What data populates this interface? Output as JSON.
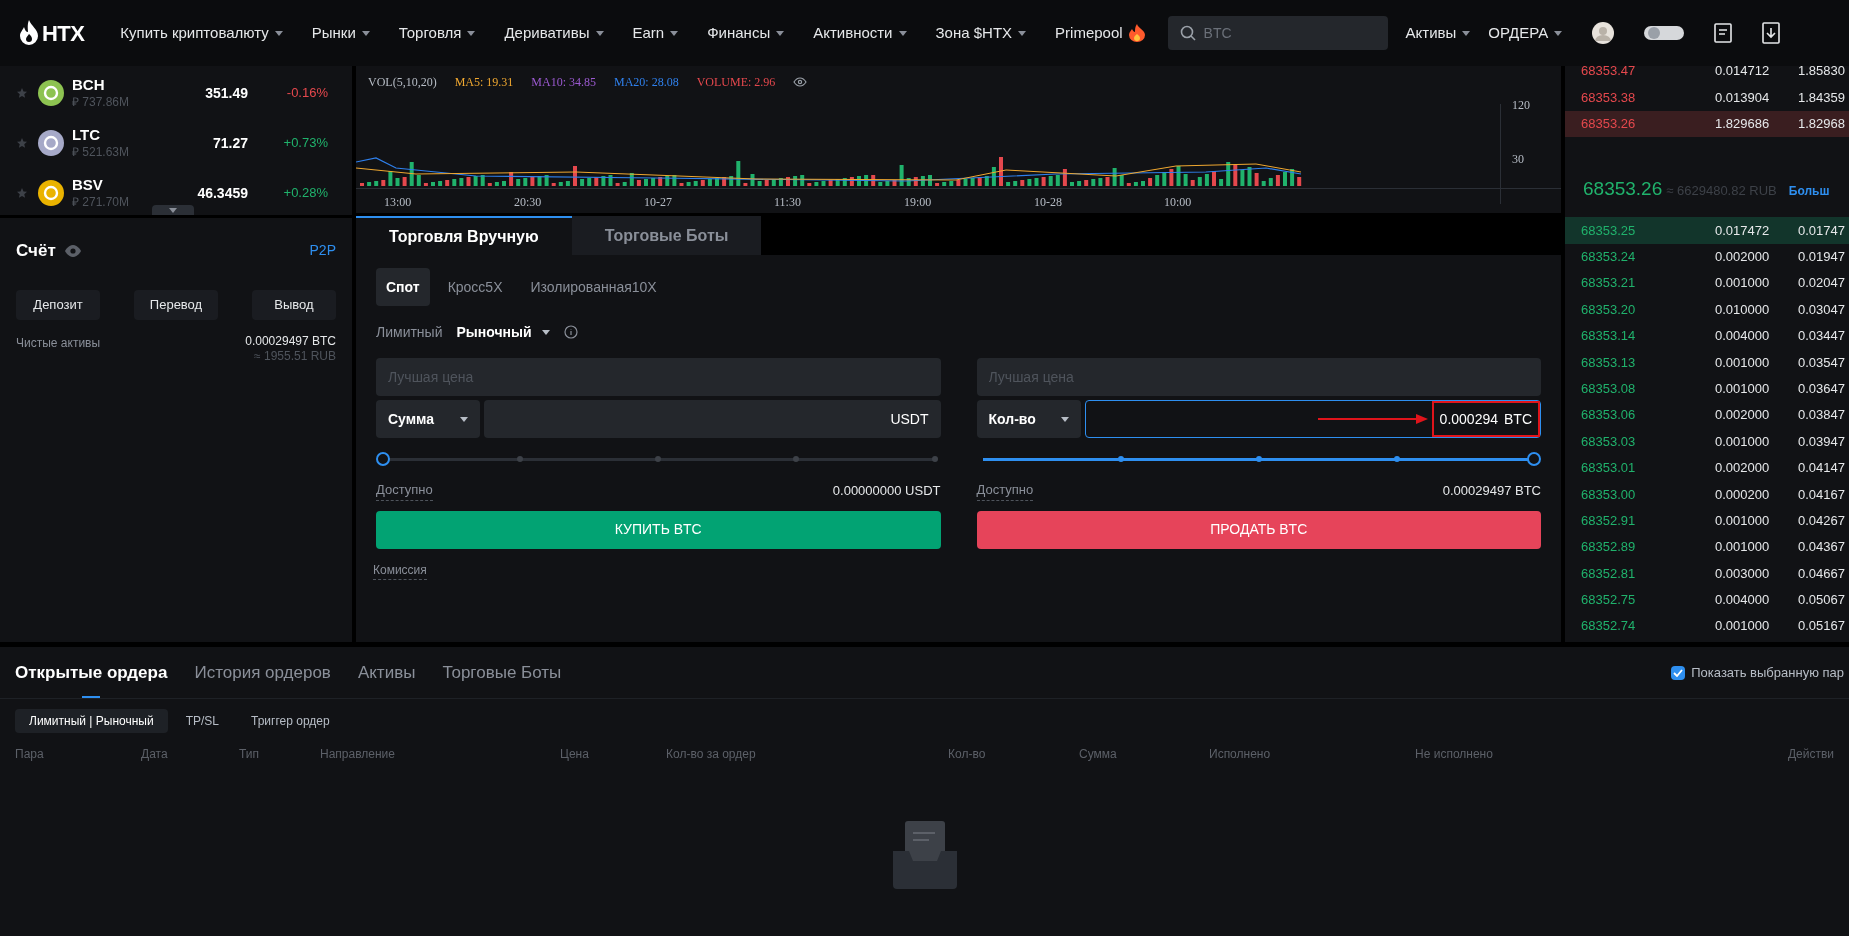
{
  "header": {
    "logo": "HTX",
    "nav": [
      {
        "label": "Купить криптовалюту",
        "has_menu": true,
        "hot": false
      },
      {
        "label": "Рынки",
        "has_menu": true,
        "hot": false
      },
      {
        "label": "Торговля",
        "has_menu": true,
        "hot": false
      },
      {
        "label": "Деривативы",
        "has_menu": true,
        "hot": false
      },
      {
        "label": "Earn",
        "has_menu": true,
        "hot": false
      },
      {
        "label": "Финансы",
        "has_menu": true,
        "hot": false
      },
      {
        "label": "Активности",
        "has_menu": true,
        "hot": false
      },
      {
        "label": "Зона $HTX",
        "has_menu": true,
        "hot": false
      },
      {
        "label": "Primepool",
        "has_menu": false,
        "hot": true
      }
    ],
    "search": {
      "placeholder": "BTC"
    },
    "right_menus": [
      {
        "label": "Активы"
      },
      {
        "label": "ОРДЕРА"
      }
    ]
  },
  "markets": [
    {
      "symbol": "BCH",
      "volume": "₽ 737.86M",
      "price": "351.49",
      "change": "-0.16%",
      "falling": true,
      "color": "#8dc351"
    },
    {
      "symbol": "LTC",
      "volume": "₽ 521.63M",
      "price": "71.27",
      "change": "+0.73%",
      "falling": false,
      "color": "#a6a9c8"
    },
    {
      "symbol": "BSV",
      "volume": "₽ 271.70M",
      "price": "46.3459",
      "change": "+0.28%",
      "falling": false,
      "color": "#eab300"
    }
  ],
  "account": {
    "title": "Счёт",
    "link": "P2P",
    "buttons": [
      "Депозит",
      "Перевод",
      "Вывод"
    ],
    "net_label": "Чистые активы",
    "net_value": "0.00029497 BTC",
    "net_approx": "≈ 1955.51 RUB"
  },
  "chart": {
    "legend": [
      {
        "text": "VOL(5,10,20)",
        "color": "#b7bdc6"
      },
      {
        "text": "MA5: 19.31",
        "color": "#f0a830"
      },
      {
        "text": "MA10: 34.85",
        "color": "#9b59d0"
      },
      {
        "text": "MA20: 28.08",
        "color": "#2f80ed"
      },
      {
        "text": "VOLUME: 2.96",
        "color": "#e5484d"
      }
    ],
    "y_labels": [
      "120",
      "30"
    ],
    "x_labels": [
      "13:00",
      "20:30",
      "10-27",
      "11:30",
      "19:00",
      "10-28",
      "10:00"
    ]
  },
  "trade": {
    "tabs": [
      {
        "label": "Торговля Вручную",
        "selected": true
      },
      {
        "label": "Торговые Боты",
        "selected": false
      }
    ],
    "margin_tabs": [
      {
        "label": "Спот",
        "selected": true
      },
      {
        "label": "Кросс5X",
        "selected": false
      },
      {
        "label": "Изолированная10X",
        "selected": false
      }
    ],
    "order_types": [
      {
        "label": "Лимитный",
        "selected": false,
        "has_menu": false
      },
      {
        "label": "Рыночный",
        "selected": true,
        "has_menu": true
      }
    ],
    "sides": [
      {
        "kind": "buy",
        "price_placeholder": "Лучшая цена",
        "selector": "Сумма",
        "unit": "USDT",
        "focused": false,
        "highlighted": false,
        "level": 0,
        "available_label": "Доступно",
        "available": "0.00000000 USDT",
        "action": "КУПИТЬ BTC"
      },
      {
        "kind": "sell",
        "price_placeholder": "Лучшая цена",
        "selector": "Кол-во",
        "value": "0.000294",
        "unit": "BTC",
        "focused": true,
        "highlighted": true,
        "level": 1,
        "available_label": "Доступно",
        "available": "0.00029497 BTC",
        "action": "ПРОДАТЬ BTC"
      }
    ],
    "fee_label": "Комиссия"
  },
  "orderbook": {
    "asks": [
      {
        "price": "68353.47",
        "amount": "0.014712",
        "total": "1.85830",
        "highlighted": false
      },
      {
        "price": "68353.38",
        "amount": "0.013904",
        "total": "1.84359",
        "highlighted": false
      },
      {
        "price": "68353.26",
        "amount": "1.829686",
        "total": "1.82968",
        "highlighted": true
      }
    ],
    "last_price": "68353.26",
    "last_approx": "≈ 6629480.82 RUB",
    "more_link": "Больш",
    "bids": [
      {
        "price": "68353.25",
        "amount": "0.017472",
        "total": "0.01747",
        "highlighted": true
      },
      {
        "price": "68353.24",
        "amount": "0.002000",
        "total": "0.01947",
        "highlighted": false
      },
      {
        "price": "68353.21",
        "amount": "0.001000",
        "total": "0.02047",
        "highlighted": false
      },
      {
        "price": "68353.20",
        "amount": "0.010000",
        "total": "0.03047",
        "highlighted": false
      },
      {
        "price": "68353.14",
        "amount": "0.004000",
        "total": "0.03447",
        "highlighted": false
      },
      {
        "price": "68353.13",
        "amount": "0.001000",
        "total": "0.03547",
        "highlighted": false
      },
      {
        "price": "68353.08",
        "amount": "0.001000",
        "total": "0.03647",
        "highlighted": false
      },
      {
        "price": "68353.06",
        "amount": "0.002000",
        "total": "0.03847",
        "highlighted": false
      },
      {
        "price": "68353.03",
        "amount": "0.001000",
        "total": "0.03947",
        "highlighted": false
      },
      {
        "price": "68353.01",
        "amount": "0.002000",
        "total": "0.04147",
        "highlighted": false
      },
      {
        "price": "68353.00",
        "amount": "0.000200",
        "total": "0.04167",
        "highlighted": false
      },
      {
        "price": "68352.91",
        "amount": "0.001000",
        "total": "0.04267",
        "highlighted": false
      },
      {
        "price": "68352.89",
        "amount": "0.001000",
        "total": "0.04367",
        "highlighted": false
      },
      {
        "price": "68352.81",
        "amount": "0.003000",
        "total": "0.04667",
        "highlighted": false
      },
      {
        "price": "68352.75",
        "amount": "0.004000",
        "total": "0.05067",
        "highlighted": false
      },
      {
        "price": "68352.74",
        "amount": "0.001000",
        "total": "0.05167",
        "highlighted": false
      }
    ]
  },
  "orders": {
    "tabs": [
      {
        "label": "Открытые ордера",
        "selected": true
      },
      {
        "label": "История ордеров",
        "selected": false
      },
      {
        "label": "Активы",
        "selected": false
      },
      {
        "label": "Торговые Боты",
        "selected": false
      }
    ],
    "filter": {
      "label": "Показать выбранную пар",
      "checked": true
    },
    "subtabs": [
      {
        "label": "Лимитный | Рыночный",
        "selected": true
      },
      {
        "label": "TP/SL",
        "selected": false
      },
      {
        "label": "Триггер ордер",
        "selected": false
      }
    ],
    "columns": [
      "Пара",
      "Дата",
      "Тип",
      "Направление",
      "Цена",
      "Кол-во за ордер",
      "Кол-во",
      "Сумма",
      "Исполнено",
      "Не исполнено",
      "Действи"
    ]
  }
}
